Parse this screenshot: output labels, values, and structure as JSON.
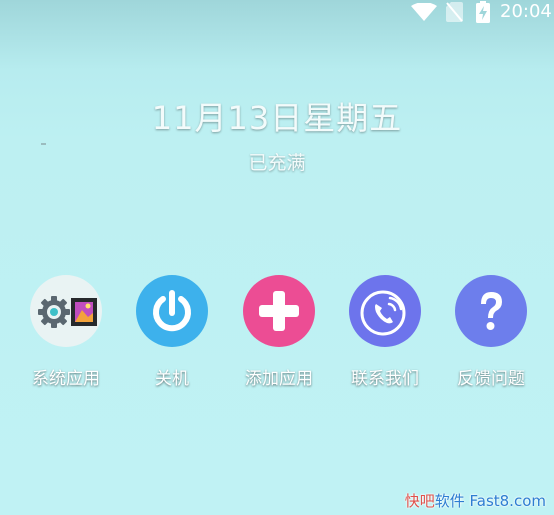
{
  "status_bar": {
    "time": "20:04",
    "icons": [
      "wifi-icon",
      "no-sim-icon",
      "battery-charging-icon"
    ]
  },
  "lock_screen": {
    "date": "11月13日星期五",
    "charge_status": "已充满"
  },
  "shortcuts": [
    {
      "label": "系统应用",
      "icon": "system-apps-icon",
      "color": "#e9f3f3"
    },
    {
      "label": "关机",
      "icon": "power-icon",
      "color": "#3db1ec"
    },
    {
      "label": "添加应用",
      "icon": "plus-icon",
      "color": "#ec4d94"
    },
    {
      "label": "联系我们",
      "icon": "phone-icon",
      "color": "#6d74ec"
    },
    {
      "label": "反馈问题",
      "icon": "question-icon",
      "color": "#6d7eec"
    }
  ],
  "watermark": {
    "part1": "快吧",
    "part2": "软件",
    "part3": " Fast8.com"
  }
}
